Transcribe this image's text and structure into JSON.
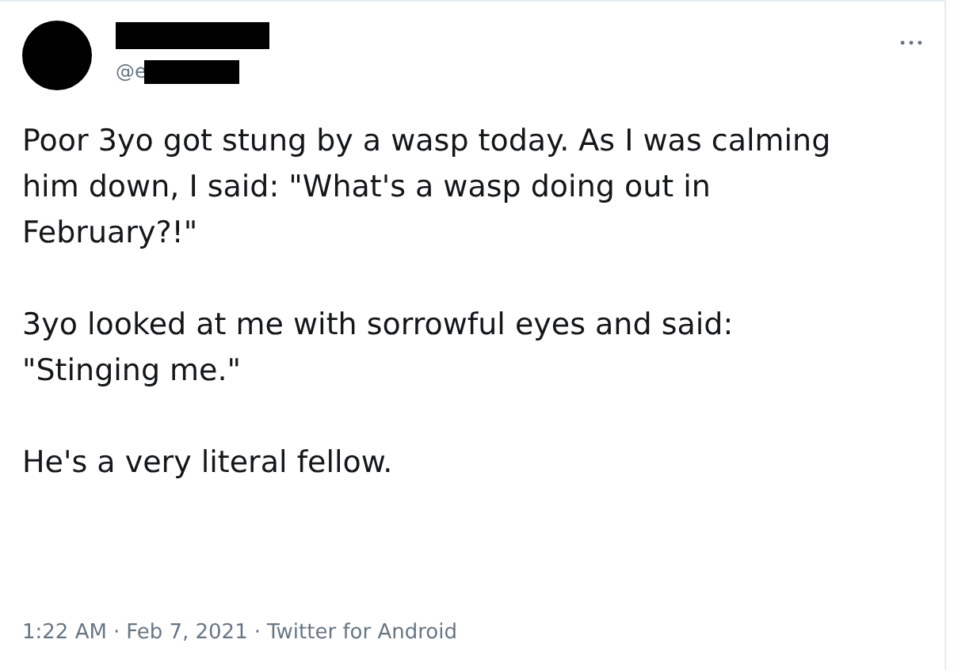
{
  "tweet": {
    "author": {
      "handle": "@e",
      "name_redacted": true,
      "handle_redacted": true
    },
    "paragraphs": [
      [
        "Poor 3yo got stung by a wasp today. As I was calming",
        "him down, I said: \"What's a wasp doing out in",
        "February?!\""
      ],
      [
        "3yo looked at me with sorrowful eyes and said:",
        "\"Stinging me.\""
      ],
      [
        "He's a very literal fellow."
      ]
    ],
    "time": "1:22 AM",
    "separator_1": "·",
    "date": "Feb 7, 2021",
    "separator_2": "·",
    "source": "Twitter for Android"
  }
}
